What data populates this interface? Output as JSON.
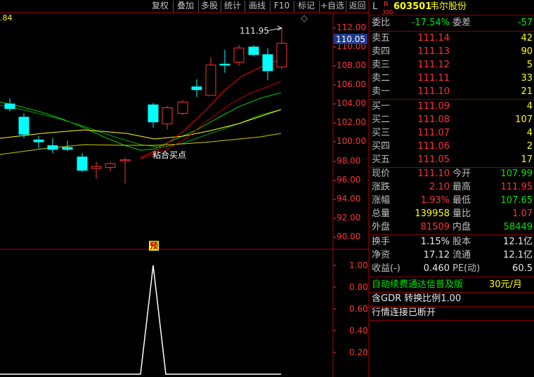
{
  "toolbar": {
    "buttons": [
      "复权",
      "叠加",
      "多股",
      "统计",
      "画线",
      "F10",
      "标记",
      "+自选",
      "返回"
    ],
    "diamond": "◇"
  },
  "chart": {
    "corner_value": ".84",
    "price_axis": [
      "112.00",
      "110.00",
      "108.00",
      "106.00",
      "104.00",
      "102.00",
      "100.00",
      "98.00",
      "96.00",
      "94.00",
      "92.00",
      "90.00"
    ],
    "current_price_tag": "110.05",
    "high_marker": "111.95",
    "annotation": "粘合买点",
    "yu_marker": "预",
    "indicator_axis": [
      "1.00",
      "0.80",
      "0.60",
      "0.40",
      "0.20"
    ],
    "colors": {
      "up": "#ff3232",
      "down": "#00ffff",
      "ma_red": "#ff0000",
      "ma_yellow": "#ffff00",
      "ma_green": "#00c800"
    }
  },
  "quote": {
    "header": {
      "prefix": "L",
      "r_mark": "R",
      "r_sub": "300",
      "code": "603501",
      "name": "韦尔股份"
    },
    "weibi": {
      "label": "委比",
      "value": "-17.54%",
      "label2": "委差",
      "value2": "-57"
    },
    "asks": [
      {
        "label": "卖五",
        "price": "111.14",
        "vol": "42"
      },
      {
        "label": "卖四",
        "price": "111.13",
        "vol": "90"
      },
      {
        "label": "卖三",
        "price": "111.12",
        "vol": "5"
      },
      {
        "label": "卖二",
        "price": "111.11",
        "vol": "33"
      },
      {
        "label": "卖一",
        "price": "111.10",
        "vol": "21"
      }
    ],
    "bids": [
      {
        "label": "买一",
        "price": "111.09",
        "vol": "4"
      },
      {
        "label": "买二",
        "price": "111.08",
        "vol": "107"
      },
      {
        "label": "买三",
        "price": "111.07",
        "vol": "4"
      },
      {
        "label": "买四",
        "price": "111.06",
        "vol": "2"
      },
      {
        "label": "买五",
        "price": "111.05",
        "vol": "17"
      }
    ],
    "stats": [
      {
        "l1": "现价",
        "v1": "111.10",
        "c1": "red",
        "l2": "今开",
        "v2": "107.99",
        "c2": "green"
      },
      {
        "l1": "涨跌",
        "v1": "2.10",
        "c1": "red",
        "l2": "最高",
        "v2": "111.95",
        "c2": "red"
      },
      {
        "l1": "涨幅",
        "v1": "1.93%",
        "c1": "red",
        "l2": "最低",
        "v2": "107.65",
        "c2": "green"
      },
      {
        "l1": "总量",
        "v1": "139958",
        "c1": "yellow",
        "l2": "量比",
        "v2": "1.07",
        "c2": "red"
      },
      {
        "l1": "外盘",
        "v1": "81509",
        "c1": "red",
        "l2": "内盘",
        "v2": "58449",
        "c2": "green"
      }
    ],
    "fund": [
      {
        "l1": "换手",
        "v1": "1.15%",
        "l2": "股本",
        "v2": "12.1亿"
      },
      {
        "l1": "净资",
        "v1": "17.12",
        "l2": "流通",
        "v2": "12.1亿"
      },
      {
        "l1": "收益(-)",
        "v1": "0.460",
        "l2": "PE(动)",
        "v2": "60.5"
      }
    ],
    "promo": {
      "text": "自动续费通达信普及版",
      "price": "30元/月"
    },
    "gdr": "含GDR 转换比例1.00",
    "status": "行情连接已断开"
  }
}
